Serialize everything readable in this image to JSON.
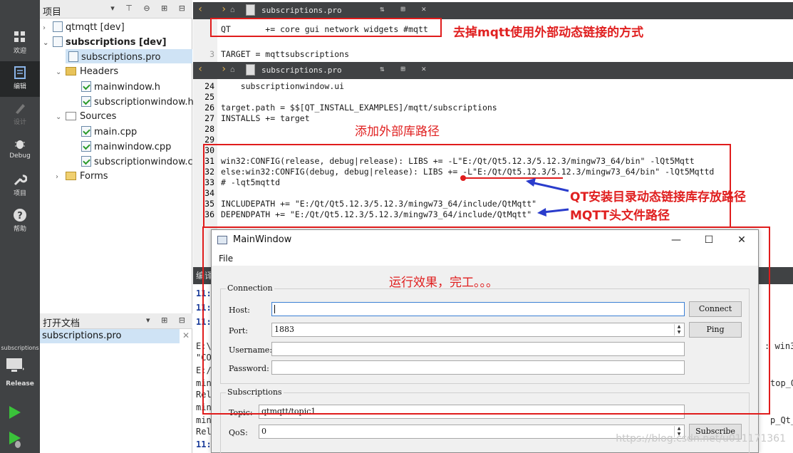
{
  "modes": [
    {
      "label": "欢迎",
      "icon": "grid-icon"
    },
    {
      "label": "编辑",
      "icon": "edit-icon"
    },
    {
      "label": "设计",
      "icon": "pen-icon"
    },
    {
      "label": "Debug",
      "icon": "bug-icon"
    },
    {
      "label": "项目",
      "icon": "wrench-icon"
    },
    {
      "label": "帮助",
      "icon": "help-icon"
    }
  ],
  "kit": {
    "project": "subscriptions",
    "config": "Release"
  },
  "project_pane": {
    "title": "项目",
    "tree": [
      {
        "label": "qtmqtt [dev]"
      },
      {
        "label": "subscriptions [dev]"
      },
      {
        "label": "subscriptions.pro"
      },
      {
        "label": "Headers"
      },
      {
        "label": "mainwindow.h"
      },
      {
        "label": "subscriptionwindow.h"
      },
      {
        "label": "Sources"
      },
      {
        "label": "main.cpp"
      },
      {
        "label": "mainwindow.cpp"
      },
      {
        "label": "subscriptionwindow.cpp"
      },
      {
        "label": "Forms"
      }
    ]
  },
  "open_docs": {
    "title": "打开文档",
    "items": [
      "subscriptions.pro"
    ]
  },
  "editor1": {
    "filename": "subscriptions.pro",
    "lines": [
      {
        "n": "",
        "text": "QT       += core gui network widgets #mqtt"
      },
      {
        "n": "",
        "text": ""
      },
      {
        "n": "3",
        "text": "TARGET = mqttsubscriptions"
      }
    ]
  },
  "editor2": {
    "filename": "subscriptions.pro",
    "lines": [
      {
        "n": "24",
        "text": "    subscriptionwindow.ui"
      },
      {
        "n": "25",
        "text": ""
      },
      {
        "n": "26",
        "text": "target.path = $$[QT_INSTALL_EXAMPLES]/mqtt/subscriptions"
      },
      {
        "n": "27",
        "text": "INSTALLS += target"
      },
      {
        "n": "28",
        "text": ""
      },
      {
        "n": "29",
        "text": ""
      },
      {
        "n": "30",
        "text": ""
      },
      {
        "n": "31",
        "text": "win32:CONFIG(release, debug|release): LIBS += -L\"E:/Qt/Qt5.12.3/5.12.3/mingw73_64/bin\" -lQt5Mqtt"
      },
      {
        "n": "32",
        "text": "else:win32:CONFIG(debug, debug|release): LIBS += -L\"E:/Qt/Qt5.12.3/5.12.3/mingw73_64/bin\" -lQt5Mqttd"
      },
      {
        "n": "33",
        "text": "# -lqt5mqttd"
      },
      {
        "n": "34",
        "text": ""
      },
      {
        "n": "35",
        "text": "INCLUDEPATH += \"E:/Qt/Qt5.12.3/5.12.3/mingw73_64/include/QtMqtt\""
      },
      {
        "n": "36",
        "text": "DEPENDPATH += \"E:/Qt/Qt5.12.3/5.12.3/mingw73_64/include/QtMqtt\""
      }
    ]
  },
  "annotations": {
    "remove_mqtt": "去掉mqtt使用外部动态链接的方式",
    "add_lib_path": "添加外部库路径",
    "lib_dir": "QT安装目录动态链接库存放路径",
    "header_path": "MQTT头文件路径",
    "result": "运行效果，完工。。。"
  },
  "output": {
    "header": "编译",
    "lines": [
      "11:",
      "11:",
      "11:",
      "",
      "E:\\",
      "\"CO",
      "E:/",
      "min",
      "Rel",
      "min",
      "min",
      "Rel",
      "11:"
    ],
    "right_fragments": [
      ": win32",
      "top_Qt_",
      "p_Qt_5"
    ]
  },
  "main_window": {
    "title": "MainWindow",
    "menu": [
      "File"
    ],
    "connection": {
      "label": "Connection",
      "host_label": "Host:",
      "host_value": "",
      "port_label": "Port:",
      "port_value": "1883",
      "username_label": "Username:",
      "username_value": "",
      "password_label": "Password:",
      "password_value": "",
      "connect_label": "Connect",
      "ping_label": "Ping"
    },
    "subscriptions": {
      "label": "Subscriptions",
      "topic_label": "Topic:",
      "topic_value": "qtmqtt/topic1",
      "qos_label": "QoS:",
      "qos_value": "0",
      "subscribe_label": "Subscribe"
    }
  },
  "watermark": "https://blog.csdn.net/u011171361",
  "colors": {
    "annotation": "#e01c1c",
    "arrow": "#2a3ccc",
    "sidebar": "#404244"
  }
}
